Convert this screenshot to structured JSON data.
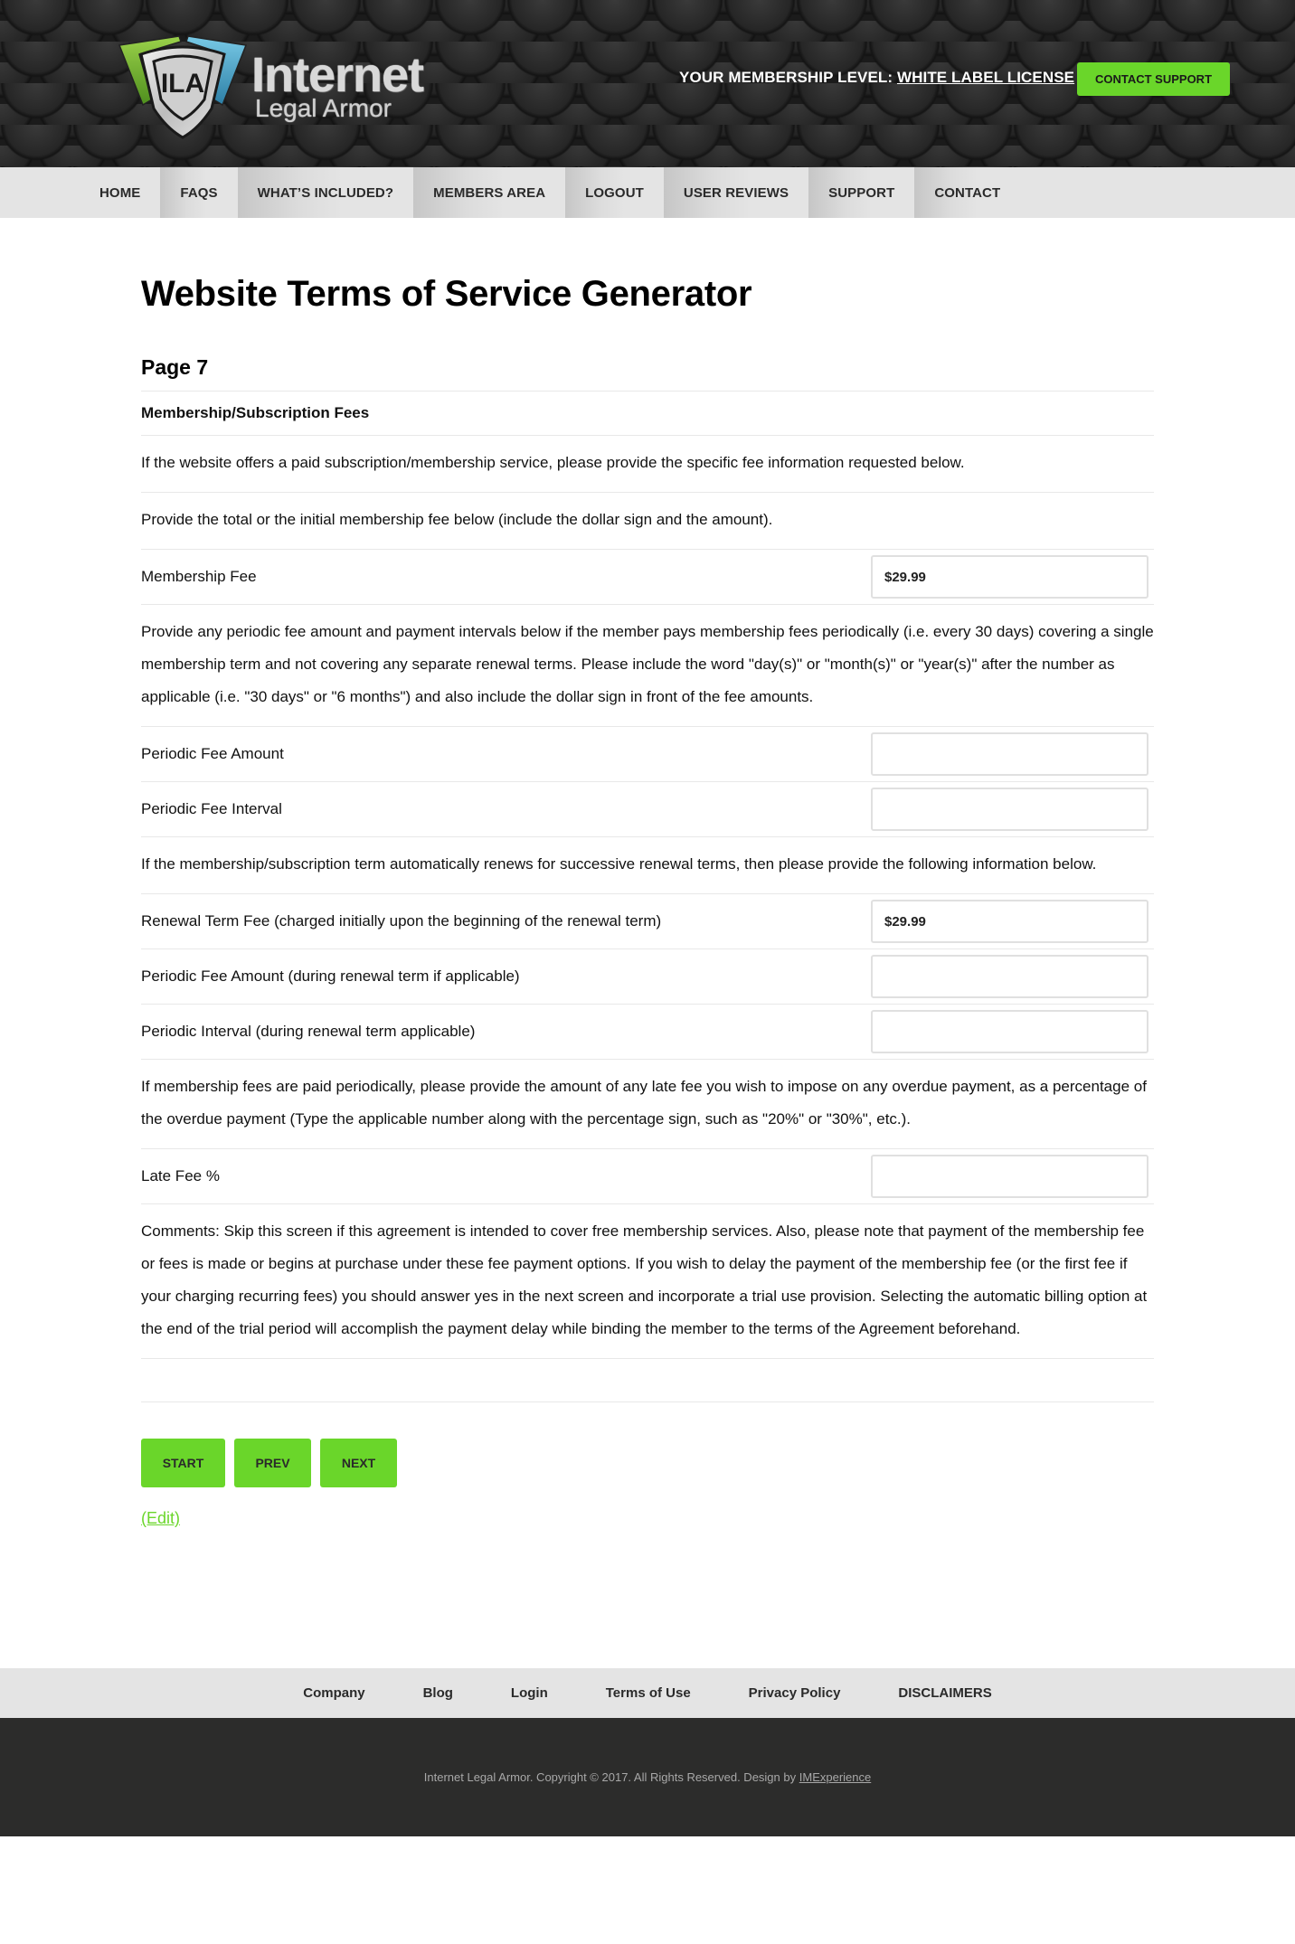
{
  "header": {
    "logo": {
      "initials": "ILA",
      "line1": "Internet",
      "line2": "Legal Armor",
      "colors": {
        "green": "#7dc142",
        "blue": "#4aafd1",
        "silver": "#c9c9c9"
      }
    },
    "membership_prefix": "YOUR MEMBERSHIP LEVEL:",
    "membership_level": "WHITE LABEL LICENSE",
    "contact_support_label": "CONTACT SUPPORT"
  },
  "nav": {
    "items": [
      {
        "label": "HOME"
      },
      {
        "label": "FAQS"
      },
      {
        "label": "WHAT’S INCLUDED?"
      },
      {
        "label": "MEMBERS AREA"
      },
      {
        "label": "LOGOUT"
      },
      {
        "label": "USER REVIEWS"
      },
      {
        "label": "SUPPORT"
      },
      {
        "label": "CONTACT"
      }
    ]
  },
  "page": {
    "title": "Website Terms of Service Generator",
    "page_label": "Page 7",
    "section_title": "Membership/Subscription Fees",
    "intro": "If the website offers a paid subscription/membership service, please provide the specific fee information requested below.",
    "initial_fee_instructions": "Provide the total or the initial membership fee below (include the dollar sign and the amount).",
    "membership_fee": {
      "label": "Membership Fee",
      "value": "$29.99"
    },
    "periodic_instructions": "Provide any periodic fee amount and payment intervals below if the member pays membership fees periodically (i.e. every 30 days) covering a single membership term and not covering any separate renewal terms. Please include the word \"day(s)\" or \"month(s)\" or \"year(s)\" after the number as applicable (i.e. \"30 days\" or \"6 months\") and also include the dollar sign in front of the fee amounts.",
    "periodic_fee_amount": {
      "label": "Periodic Fee Amount",
      "value": ""
    },
    "periodic_fee_interval": {
      "label": "Periodic Fee Interval",
      "value": ""
    },
    "renewal_instructions": "If the membership/subscription term automatically renews for successive renewal terms, then please provide the following information below.",
    "renewal_term_fee": {
      "label": "Renewal Term Fee (charged initially upon the beginning of the renewal term)",
      "value": "$29.99"
    },
    "renewal_periodic_fee_amount": {
      "label": "Periodic Fee Amount (during renewal term if applicable)",
      "value": ""
    },
    "renewal_periodic_interval": {
      "label": "Periodic Interval (during renewal term applicable)",
      "value": ""
    },
    "late_fee_instructions": "If membership fees are paid periodically, please provide the amount of any late fee you wish to impose on any overdue payment, as a percentage of the overdue payment (Type the applicable number along with the percentage sign, such as \"20%\" or \"30%\", etc.).",
    "late_fee": {
      "label": "Late Fee %",
      "value": ""
    },
    "comments": "Comments: Skip this screen if this agreement is intended to cover free membership services. Also, please note that payment of the membership fee or fees is made or begins at purchase under these fee payment options. If you wish to delay the payment of the membership fee (or the first fee if your charging recurring fees) you should answer yes in the next screen and incorporate a trial use provision. Selecting the automatic billing option at the end of the trial period will accomplish the payment delay while binding the member to the terms of the Agreement beforehand.",
    "buttons": {
      "start": "START",
      "prev": "PREV",
      "next": "NEXT"
    },
    "edit_label": "(Edit)"
  },
  "footer": {
    "links": [
      {
        "label": "Company"
      },
      {
        "label": "Blog"
      },
      {
        "label": "Login"
      },
      {
        "label": "Terms of Use"
      },
      {
        "label": "Privacy Policy"
      },
      {
        "label": "DISCLAIMERS"
      }
    ],
    "copyright": "Internet Legal Armor. Copyright © 2017. All Rights Reserved. Design by",
    "designer": "IMExperience"
  },
  "accent_color": "#6ad62a"
}
